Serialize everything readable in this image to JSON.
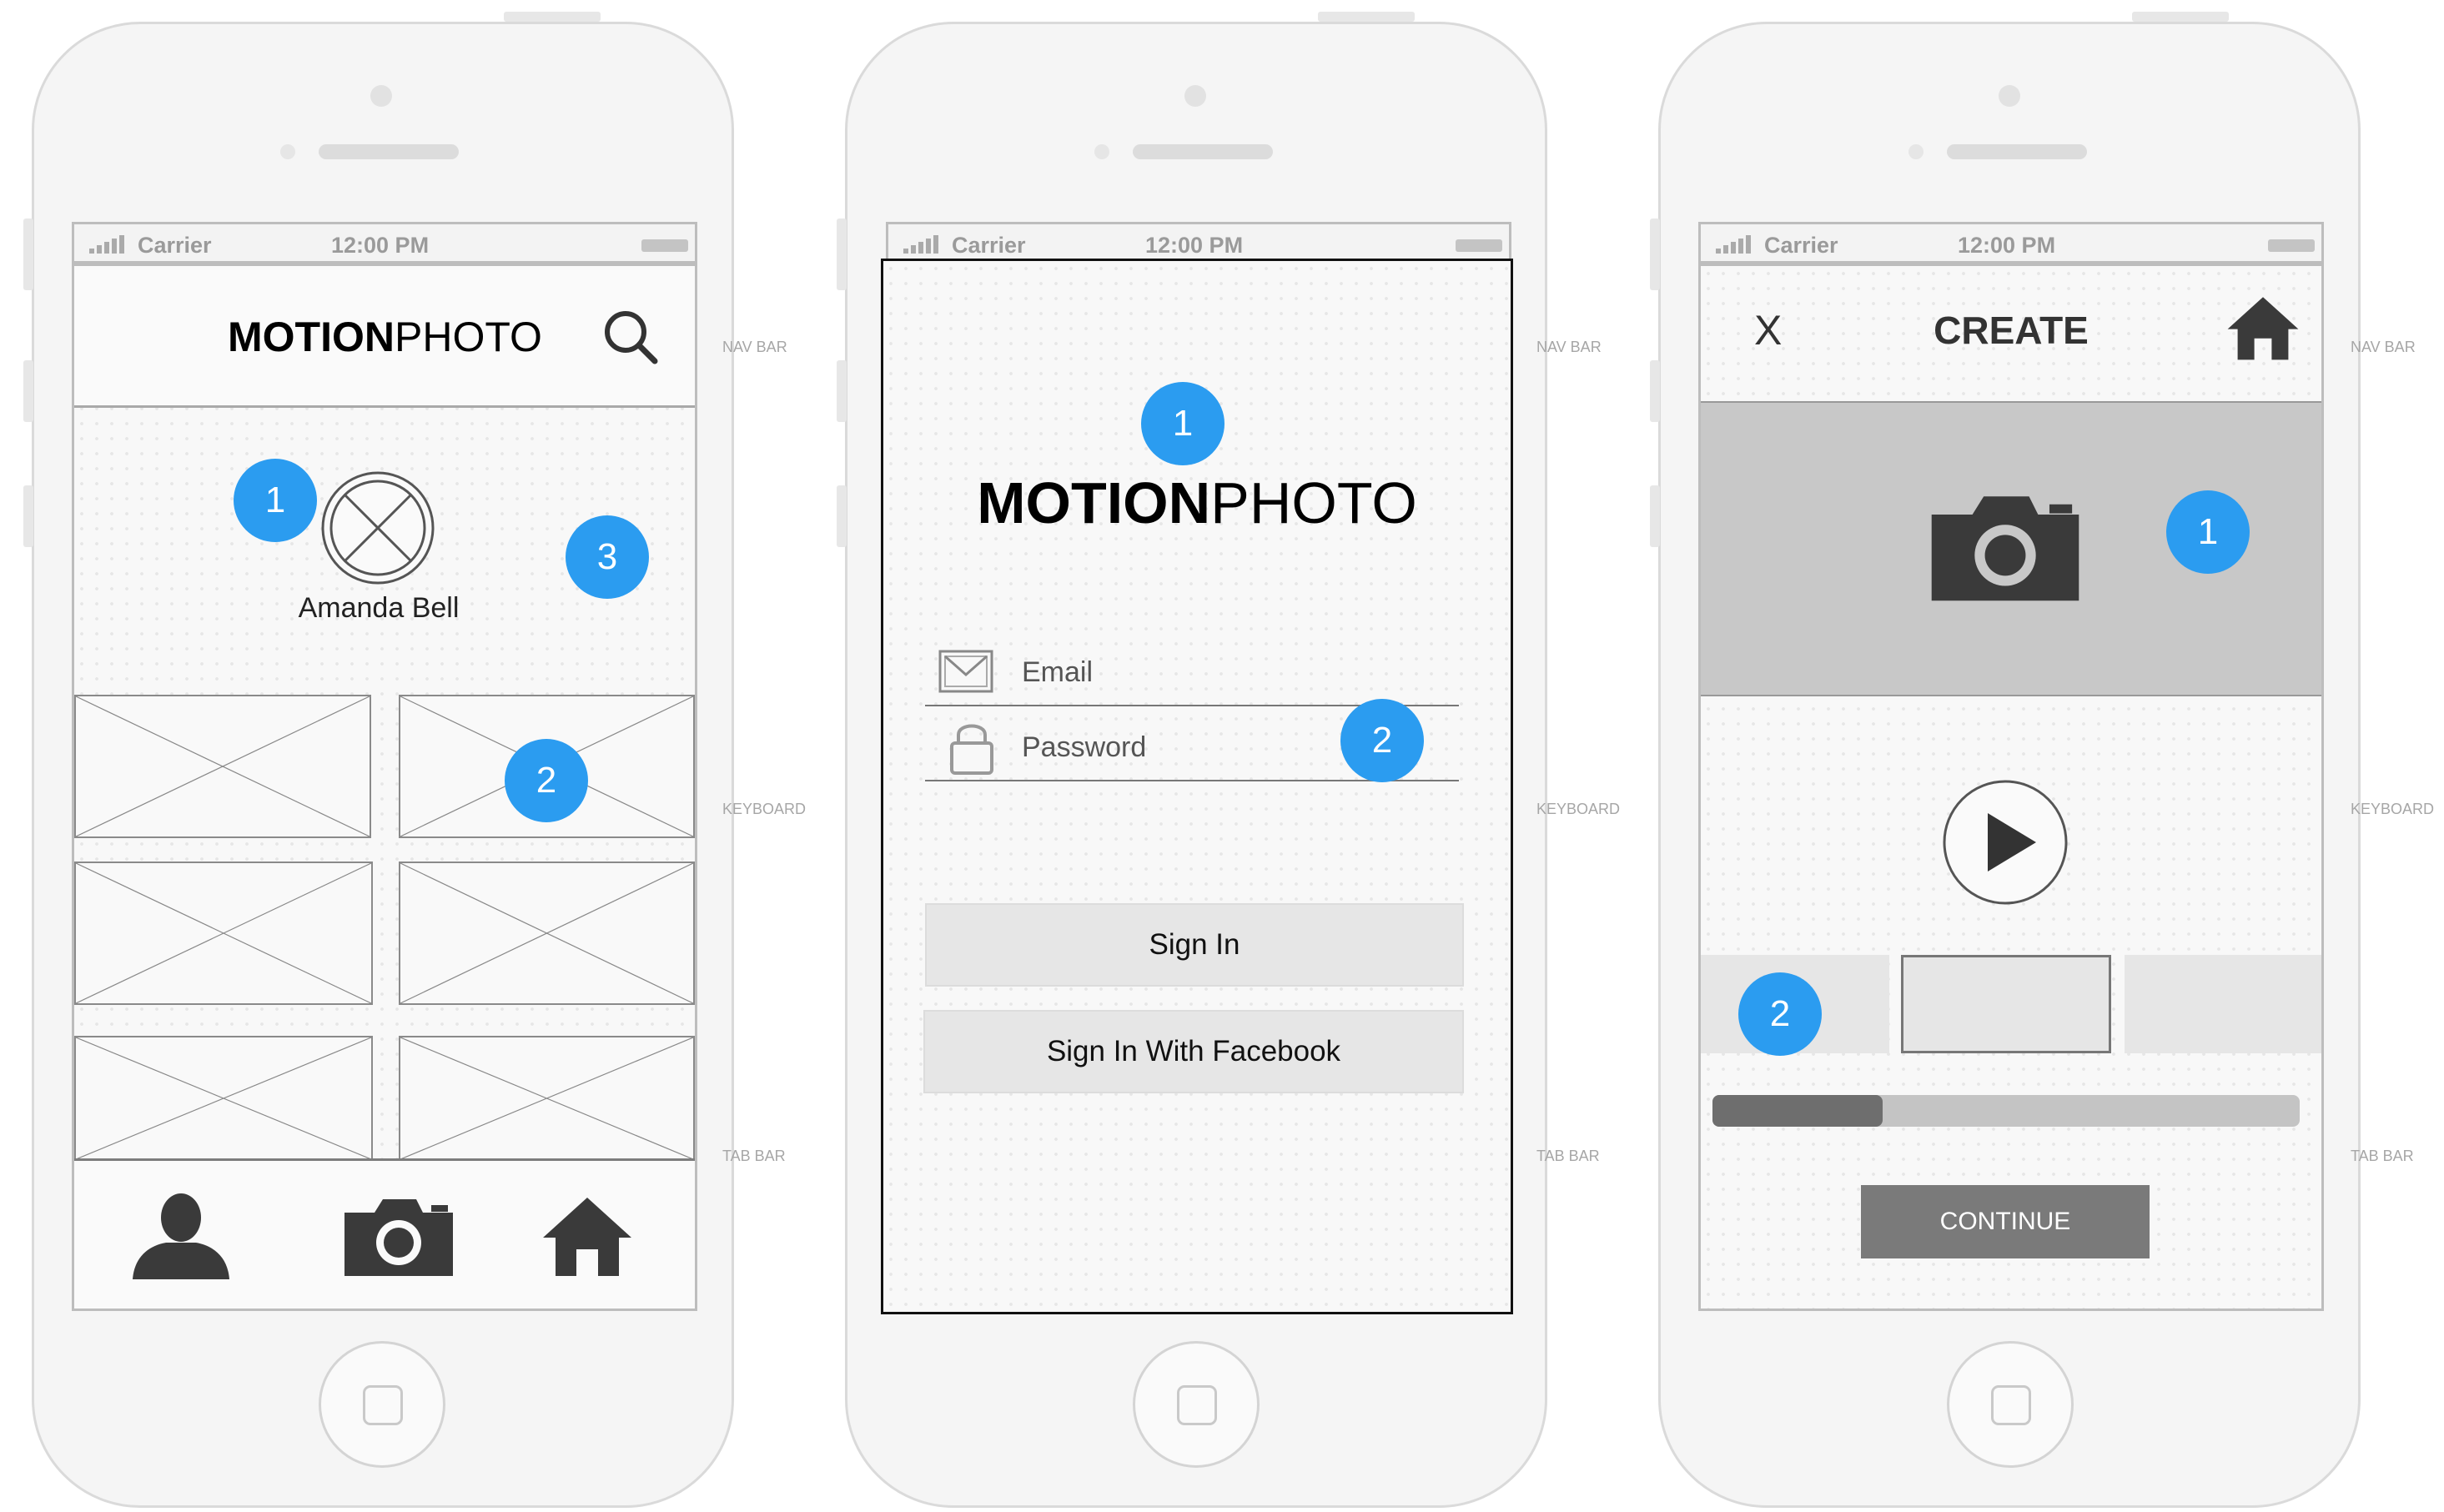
{
  "status_bar": {
    "carrier": "Carrier",
    "time": "12:00 PM"
  },
  "annotations": {
    "nav_bar": "NAV BAR",
    "keyboard": "KEYBOARD",
    "tab_bar": "TAB BAR"
  },
  "profile_screen": {
    "logo_bold": "MOTION",
    "logo_light": "PHOTO",
    "user_name": "Amanda Bell",
    "badges": [
      "1",
      "2",
      "3"
    ],
    "tab_icons": [
      "person-icon",
      "camera-icon",
      "home-icon"
    ]
  },
  "login_screen": {
    "logo_bold": "MOTION",
    "logo_light": "PHOTO",
    "email_placeholder": "Email",
    "password_placeholder": "Password",
    "sign_in": "Sign In",
    "sign_in_facebook": "Sign In With Facebook",
    "badges": [
      "1",
      "2"
    ]
  },
  "create_screen": {
    "close": "X",
    "title": "CREATE",
    "continue": "CONTINUE",
    "progress_fraction": 0.29,
    "badges": [
      "1",
      "2"
    ]
  },
  "colors": {
    "badge": "#2b9cf0",
    "continue_button": "#7a7a7a",
    "progress_fill": "#6e6e6e"
  }
}
